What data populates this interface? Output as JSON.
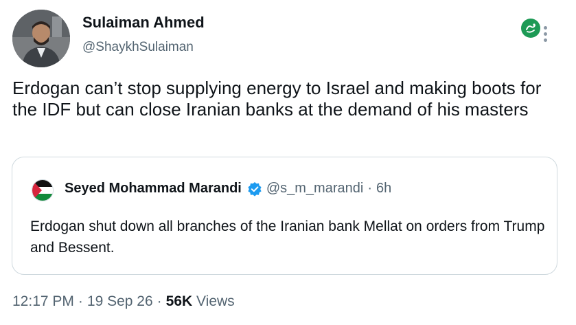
{
  "author": {
    "name": "Sulaiman Ahmed",
    "handle": "@ShaykhSulaiman"
  },
  "tweet": {
    "text": "Erdogan can’t stop supplying energy to Israel and making boots for the IDF but can close Iranian banks at the demand of his masters"
  },
  "quoted_tweet": {
    "name": "Seyed Mohammad Marandi",
    "verified": true,
    "handle": "@s_m_marandi",
    "separator": "·",
    "time": "6h",
    "text": "Erdogan shut down all branches of the Iranian bank Mellat on orders from Trump and Bessent."
  },
  "meta": {
    "time": "12:17 PM",
    "date": "19 Sep 26",
    "dot": "·",
    "views_count": "56K",
    "views_label": "Views"
  },
  "icons": {
    "top_right_logo": "grok-icon",
    "menu": "more-vertical-icon",
    "verified": "verified-badge-icon"
  },
  "colors": {
    "verified_blue": "#1d9bf0",
    "secondary_text": "#536471",
    "primary_text": "#0f1419",
    "border": "#cfd9de",
    "logo_green": "#1d9a55"
  }
}
